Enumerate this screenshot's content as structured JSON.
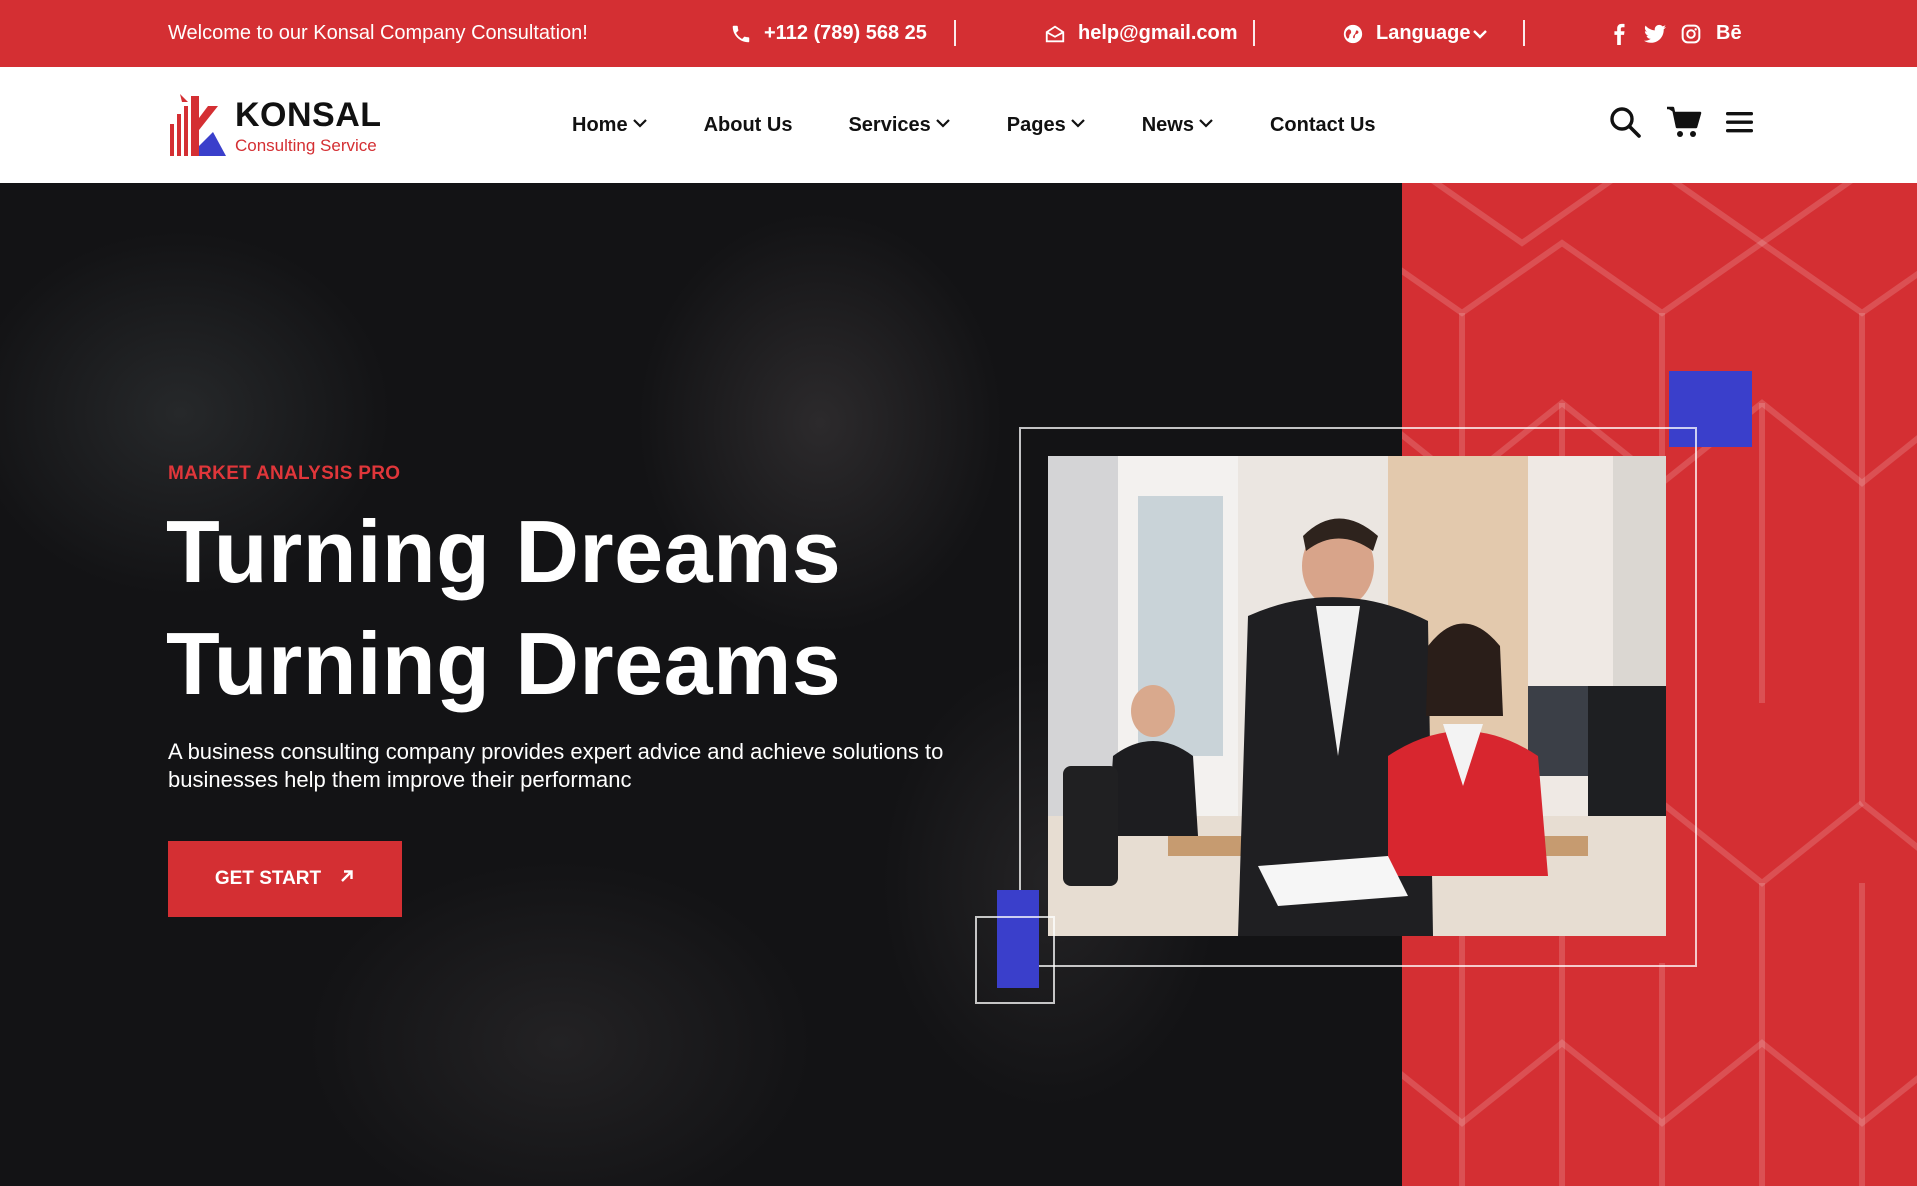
{
  "topbar": {
    "welcome": "Welcome to our Konsal Company Consultation!",
    "phone": "+112 (789) 568 25",
    "email": "help@gmail.com",
    "language": "Language",
    "socials": [
      "facebook-icon",
      "twitter-icon",
      "instagram-icon",
      "behance-icon"
    ],
    "behance_label": "Bē"
  },
  "logo": {
    "brand": "KONSAL",
    "tagline": "Consulting Service"
  },
  "nav": {
    "items": [
      {
        "label": "Home",
        "dropdown": true
      },
      {
        "label": "About Us",
        "dropdown": false
      },
      {
        "label": "Services",
        "dropdown": true
      },
      {
        "label": "Pages",
        "dropdown": true
      },
      {
        "label": "News",
        "dropdown": true
      },
      {
        "label": "Contact Us",
        "dropdown": false
      }
    ],
    "icons": [
      "search-icon",
      "cart-icon",
      "hamburger-menu-icon"
    ]
  },
  "hero": {
    "subtitle": "MARKET ANALYSIS PRO",
    "title_line1": "Turning Dreams",
    "title_line2": "Turning Dreams",
    "description": "A business consulting company provides expert advice and achieve solutions to businesses help them improve their performanc",
    "cta_label": "GET START",
    "cta_icon": "arrow-up-right-icon"
  },
  "colors": {
    "primary_red": "#d42f33",
    "accent_blue": "#3a3fcb",
    "dark_bg": "#131315"
  }
}
